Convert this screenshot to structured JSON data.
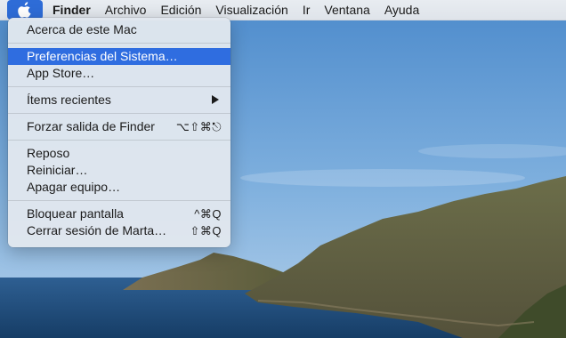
{
  "menubar": {
    "apple_icon": "apple-logo-icon",
    "items": [
      "Finder",
      "Archivo",
      "Edición",
      "Visualización",
      "Ir",
      "Ventana",
      "Ayuda"
    ]
  },
  "apple_menu": {
    "about": "Acerca de este Mac",
    "prefs": "Preferencias del Sistema…",
    "appstore": "App Store…",
    "recent": "Ítems recientes",
    "recent_icon": "submenu-arrow-icon",
    "force_quit": "Forzar salida de Finder",
    "force_quit_shortcut": "⌥⇧⌘⎋",
    "sleep": "Reposo",
    "restart": "Reiniciar…",
    "shutdown": "Apagar equipo…",
    "lock": "Bloquear pantalla",
    "lock_shortcut": "^⌘Q",
    "logout": "Cerrar sesión de Marta…",
    "logout_shortcut": "⇧⌘Q"
  },
  "colors": {
    "highlight": "#2f6de0",
    "sky": "#6fa6d8",
    "sea": "#24558a"
  }
}
